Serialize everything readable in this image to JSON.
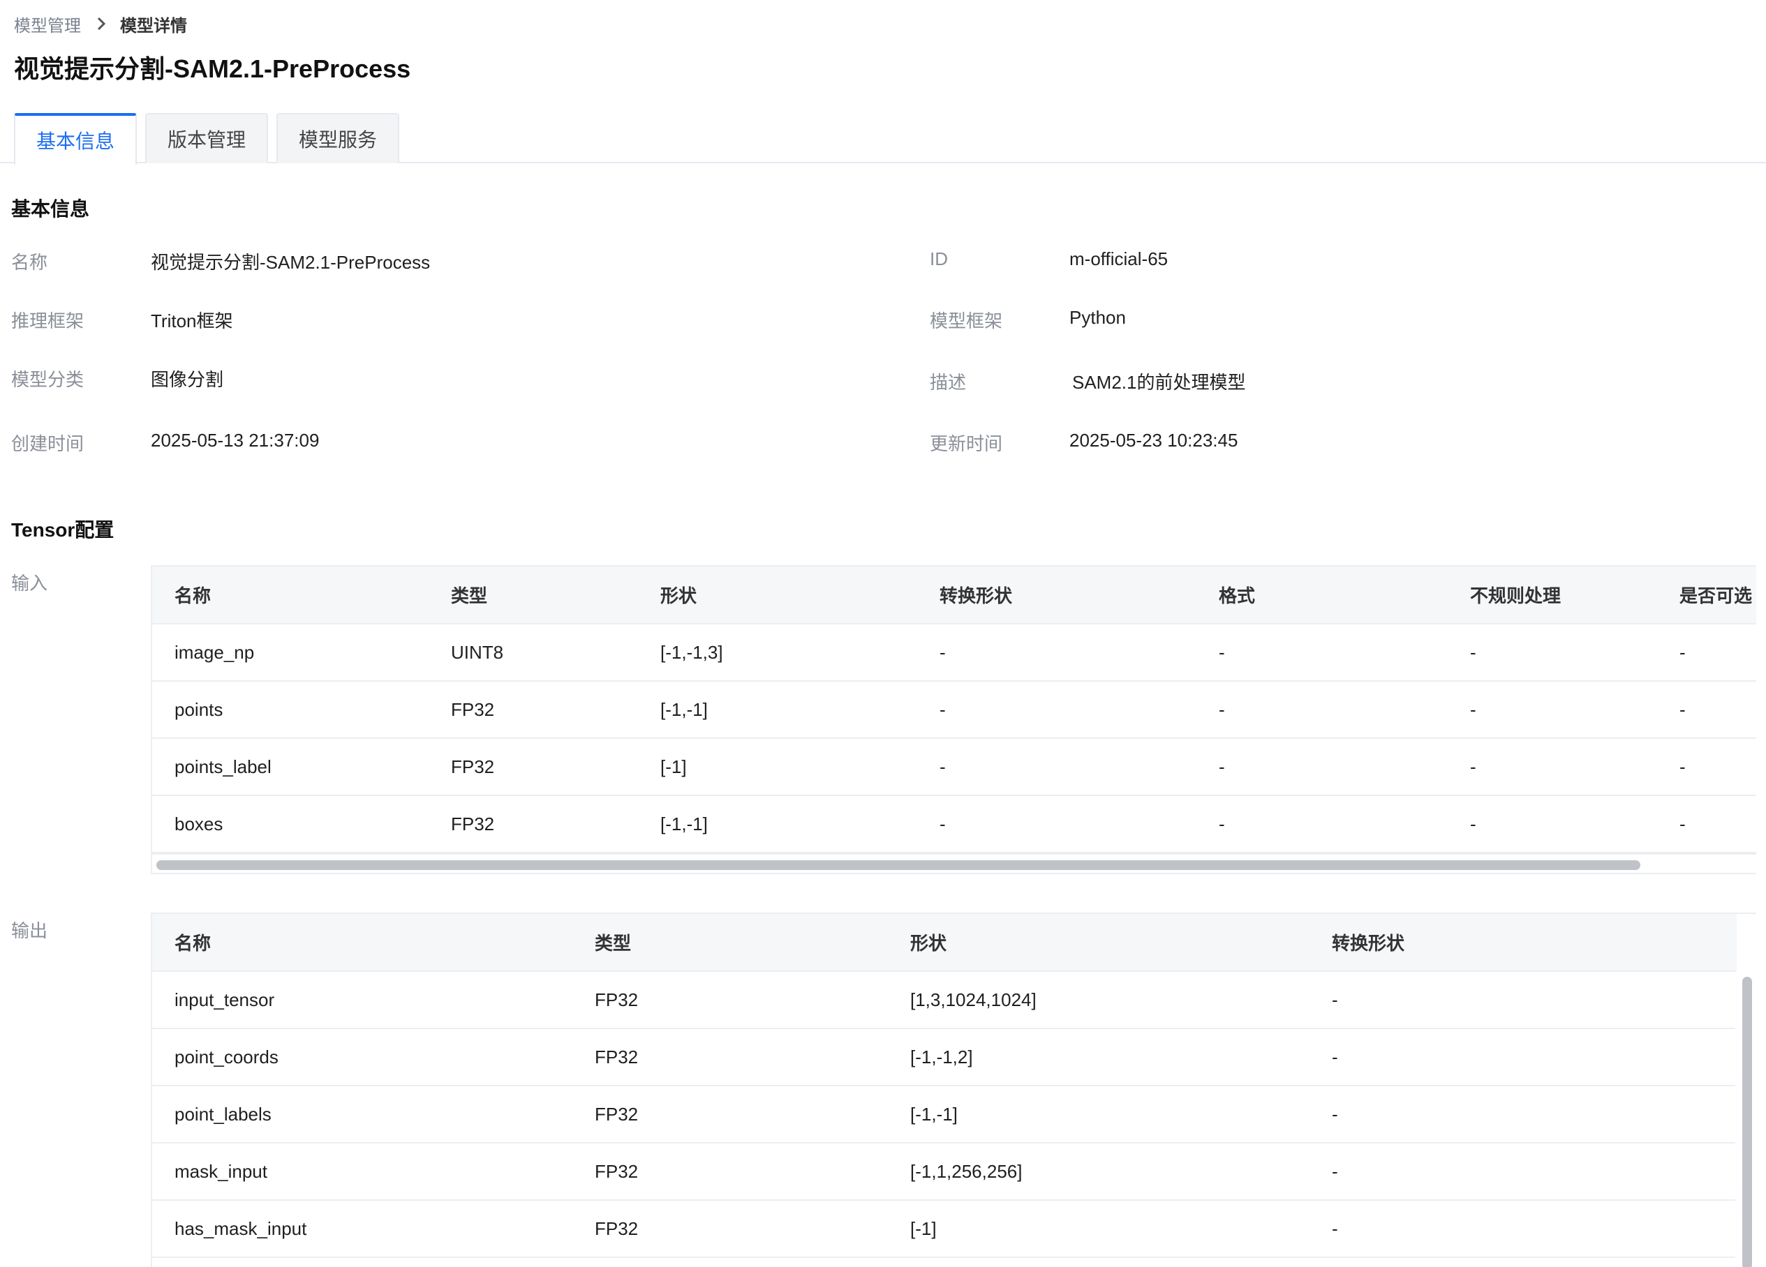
{
  "breadcrumb": {
    "parent": "模型管理",
    "current": "模型详情"
  },
  "page_title": "视觉提示分割-SAM2.1-PreProcess",
  "tabs": [
    {
      "label": "基本信息",
      "active": true
    },
    {
      "label": "版本管理",
      "active": false
    },
    {
      "label": "模型服务",
      "active": false
    }
  ],
  "basic_info": {
    "section_title": "基本信息",
    "name_label": "名称",
    "name_value": "视觉提示分割-SAM2.1-PreProcess",
    "id_label": "ID",
    "id_value": "m-official-65",
    "infer_framework_label": "推理框架",
    "infer_framework_value": "Triton框架",
    "model_framework_label": "模型框架",
    "model_framework_value": "Python",
    "category_label": "模型分类",
    "category_value": "图像分割",
    "desc_label": "描述",
    "desc_value": "SAM2.1的前处理模型",
    "created_label": "创建时间",
    "created_value": "2025-05-13 21:37:09",
    "updated_label": "更新时间",
    "updated_value": "2025-05-23 10:23:45"
  },
  "tensor": {
    "section_title": "Tensor配置",
    "input_label": "输入",
    "output_label": "输出",
    "input_columns": [
      "名称",
      "类型",
      "形状",
      "转换形状",
      "格式",
      "不规则处理",
      "是否可选"
    ],
    "input_rows": [
      [
        "image_np",
        "UINT8",
        "[-1,-1,3]",
        "-",
        "-",
        "-",
        "-"
      ],
      [
        "points",
        "FP32",
        "[-1,-1]",
        "-",
        "-",
        "-",
        "-"
      ],
      [
        "points_label",
        "FP32",
        "[-1]",
        "-",
        "-",
        "-",
        "-"
      ],
      [
        "boxes",
        "FP32",
        "[-1,-1]",
        "-",
        "-",
        "-",
        "-"
      ]
    ],
    "output_columns": [
      "名称",
      "类型",
      "形状",
      "转换形状"
    ],
    "output_rows": [
      [
        "input_tensor",
        "FP32",
        "[1,3,1024,1024]",
        "-"
      ],
      [
        "point_coords",
        "FP32",
        "[-1,-1,2]",
        "-"
      ],
      [
        "point_labels",
        "FP32",
        "[-1,-1]",
        "-"
      ],
      [
        "mask_input",
        "FP32",
        "[-1,1,256,256]",
        "-"
      ],
      [
        "has_mask_input",
        "FP32",
        "[-1]",
        "-"
      ]
    ]
  },
  "colors": {
    "accent": "#1d6ef0",
    "label": "#8a8f99",
    "header_bg": "#f6f7f9"
  }
}
